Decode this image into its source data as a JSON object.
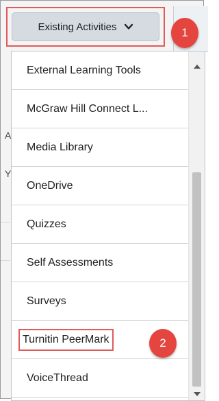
{
  "trigger": {
    "label": "Existing Activities",
    "icon": "chevron-down-icon"
  },
  "callouts": [
    "1",
    "2"
  ],
  "menu": {
    "items": [
      {
        "label": "External Learning Tools",
        "highlighted": false
      },
      {
        "label": "McGraw Hill Connect L...",
        "highlighted": false
      },
      {
        "label": "Media Library",
        "highlighted": false
      },
      {
        "label": "OneDrive",
        "highlighted": false
      },
      {
        "label": "Quizzes",
        "highlighted": false
      },
      {
        "label": "Self Assessments",
        "highlighted": false
      },
      {
        "label": "Surveys",
        "highlighted": false
      },
      {
        "label": "Turnitin PeerMark",
        "highlighted": true
      },
      {
        "label": "VoiceThread",
        "highlighted": false
      }
    ]
  },
  "background_fragments": [
    "A",
    "Y"
  ],
  "colors": {
    "annotation": "#e15b5b",
    "badge": "#e4463f",
    "button": "#d6dbe2"
  }
}
